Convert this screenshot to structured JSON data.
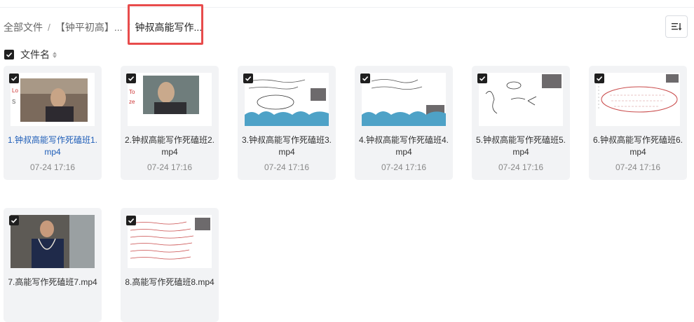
{
  "breadcrumb": {
    "items": [
      {
        "label": "全部文件"
      },
      {
        "label": "【钟平初高】..."
      },
      {
        "label": "钟叔高能写作..."
      }
    ],
    "separator": "/"
  },
  "list_header": {
    "name_label": "文件名"
  },
  "sort_button": {
    "icon": "sort-list-icon"
  },
  "files": [
    {
      "name": "1.钟叔高能写作死磕班1.mp4",
      "time": "07-24 17:16",
      "thumb": "video-teacher",
      "active": true
    },
    {
      "name": "2.钟叔高能写作死磕班2.mp4",
      "time": "07-24 17:16",
      "thumb": "video-teacher-close",
      "active": false
    },
    {
      "name": "3.钟叔高能写作死磕班3.mp4",
      "time": "07-24 17:16",
      "thumb": "whiteboard-handwriting",
      "active": false
    },
    {
      "name": "4.钟叔高能写作死磕班4.mp4",
      "time": "07-24 17:16",
      "thumb": "whiteboard-handwriting",
      "active": false
    },
    {
      "name": "5.钟叔高能写作死磕班5.mp4",
      "time": "07-24 17:16",
      "thumb": "whiteboard-sketch",
      "active": false
    },
    {
      "name": "6.钟叔高能写作死磕班6.mp4",
      "time": "07-24 17:16",
      "thumb": "whiteboard-red-oval",
      "active": false
    },
    {
      "name": "7.高能写作死磕班7.mp4",
      "time": "",
      "thumb": "video-teacher-standing",
      "active": false
    },
    {
      "name": "8.高能写作死磕班8.mp4",
      "time": "",
      "thumb": "whiteboard-red-text",
      "active": false
    }
  ],
  "colors": {
    "accent": "#1f5eb8",
    "highlight": "#e84c4c",
    "card_bg": "#f2f3f5"
  }
}
